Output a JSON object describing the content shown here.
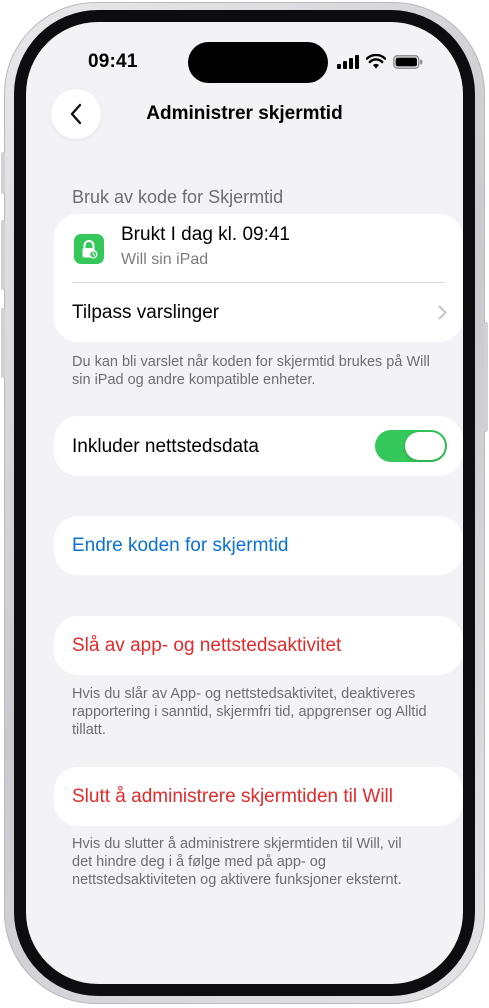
{
  "status_bar": {
    "time": "09:41"
  },
  "nav": {
    "title": "Administrer skjermtid",
    "back_icon": "chevron-left-icon"
  },
  "usage_section": {
    "header": "Bruk av kode for Skjermtid",
    "used_row": {
      "title": "Brukt I dag kl. 09:41",
      "subtitle": "Will sin iPad",
      "icon": "lock-icon"
    },
    "notify_row": {
      "label": "Tilpass varslinger"
    },
    "footnote": "Du kan bli varslet når koden for skjermtid brukes på Will sin iPad og andre kompatible enheter."
  },
  "website_data": {
    "label": "Inkluder nettstedsdata",
    "enabled": true
  },
  "change_code": {
    "label": "Endre koden for skjermtid"
  },
  "disable_activity": {
    "label": "Slå av app- og nettstedsaktivitet",
    "footnote": "Hvis du slår av App- og nettstedsaktivitet, deaktiveres rapportering i sanntid, skjermfri tid, appgrenser og Alltid tillatt."
  },
  "stop_managing": {
    "label": "Slutt å administrere skjermtiden til Will",
    "footnote": "Hvis du slutter å administrere skjermtiden til Will, vil det hindre deg i å følge med på app- og nettstedsaktiviteten og aktivere funksjoner eksternt."
  },
  "colors": {
    "accent_blue": "#0a72d6",
    "destructive_red": "#e22a2a",
    "toggle_green": "#34c759",
    "background": "#f2f2f7"
  }
}
